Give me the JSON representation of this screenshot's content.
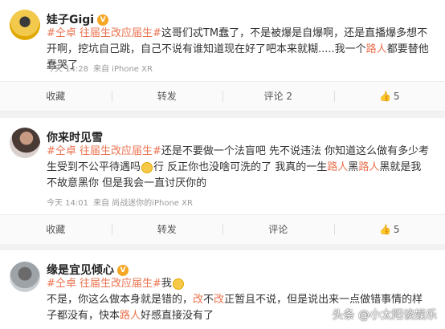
{
  "posts": [
    {
      "name": "娃子Gigi",
      "content": [
        "#仝卓 往届生改应届生#",
        "这哥们忒TM蠢了，不是被爆是自爆啊，还是直播爆多想不开啊，挖坑自己跳，自己不说有谁知道现在好了吧本来就糊.....我一个",
        "路人",
        "都要替他蠢哭了"
      ],
      "time": "今天 14:28",
      "source": "来自 iPhone XR",
      "actions": {
        "collect": "收藏",
        "repost": "转发",
        "comment": "评论 2",
        "like": "5"
      }
    },
    {
      "name": "你来时见雪",
      "content": [
        "#仝卓 往届生改应届生#",
        "还是不要做一个法盲吧 先不说违法 你知道这么做有多少考生受到不公平待遇吗",
        "行 反正你也没啥可洗的了 我真的一生",
        "路人",
        "黑",
        "路人",
        "黑就是我不故意黑你 但是我会一直讨厌你的"
      ],
      "time": "今天 14:01",
      "source": "来自 尚战迷你的iPhone XR",
      "actions": {
        "collect": "收藏",
        "repost": "转发",
        "comment": "评论",
        "like": "5"
      }
    },
    {
      "name": "缘是宜见倾心",
      "content": [
        "#仝卓 往届生改应届生#",
        "我",
        "不是，你这么做本身就是错的，",
        "改",
        "不",
        "改",
        "正暂且不说，但是说出来一点做错事情的样子都没有，快本",
        "路人",
        "好感直接没有了"
      ]
    }
  ],
  "watermark": "头条 @小太阳谈娱乐"
}
